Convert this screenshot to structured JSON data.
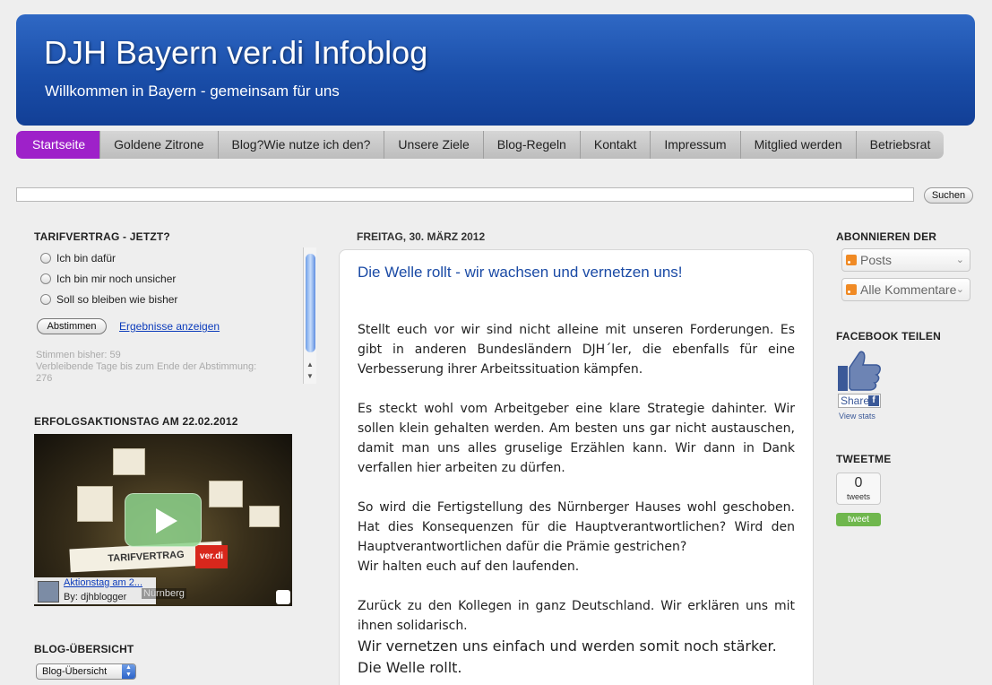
{
  "header": {
    "title": "DJH Bayern ver.di Infoblog",
    "subtitle": "Willkommen in Bayern - gemeinsam für uns",
    "accent_color": "#1a4ea9"
  },
  "nav": {
    "active_color": "#9e21c9",
    "tabs": [
      {
        "label": "Startseite"
      },
      {
        "label": "Goldene Zitrone"
      },
      {
        "label": "Blog?Wie nutze ich den?"
      },
      {
        "label": "Unsere Ziele"
      },
      {
        "label": "Blog-Regeln"
      },
      {
        "label": "Kontakt"
      },
      {
        "label": "Impressum"
      },
      {
        "label": "Mitglied werden"
      },
      {
        "label": "Betriebsrat"
      }
    ]
  },
  "search": {
    "button_label": "Suchen",
    "value": ""
  },
  "poll": {
    "title": "TARIFVERTRAG - JETZT?",
    "options": [
      "Ich bin dafür",
      "Ich bin mir noch unsicher",
      "Soll so bleiben wie bisher"
    ],
    "vote_label": "Abstimmen",
    "results_label": "Ergebnisse anzeigen",
    "votes_text": "Stimmen bisher: 59",
    "days_text": "Verbleibende Tage bis zum Ende der Abstimmung:",
    "days_value": "276"
  },
  "video": {
    "section_title": "ERFOLGSAKTIONSTAG AM 22.02.2012",
    "caption_title": "Aktionstag am 2...",
    "caption_by": "By: djhblogger",
    "location": "Nürnberg",
    "banner_text": "TARIFVERTRAG",
    "logo_text": "ver.di"
  },
  "archive": {
    "title": "BLOG-ÜBERSICHT",
    "select_value": "Blog-Übersicht"
  },
  "post": {
    "date": "FREITAG, 30. MÄRZ 2012",
    "title": "Die Welle rollt - wir wachsen und vernetzen uns!",
    "paragraphs": [
      "Stellt euch vor wir sind nicht alleine mit unseren Forderungen. Es gibt in anderen Bundesländern DJH´ler, die ebenfalls für eine Verbesserung ihrer Arbeitssituation kämpfen.",
      "Es steckt wohl vom Arbeitgeber eine klare Strategie dahinter. Wir sollen klein gehalten werden. Am besten uns gar nicht austauschen, damit man uns alles gruselige Erzählen kann. Wir dann in Dank verfallen hier arbeiten zu dürfen.",
      "So wird die Fertigstellung des Nürnberger Hauses wohl geschoben. Hat dies Konsequenzen für die Hauptverantwortlichen? Wird den Hauptverantwortlichen dafür die Prämie gestrichen?",
      "Wir halten euch auf den laufenden.",
      "Zurück zu den Kollegen in ganz Deutschland. Wir erklären uns mit ihnen solidarisch.",
      "Wir vernetzen uns einfach und werden somit noch stärker.",
      "Die Welle rollt."
    ]
  },
  "sidebar_right": {
    "subscribe_title": "ABONNIEREN DER",
    "feed_posts": "Posts",
    "feed_comments": "Alle Kommentare",
    "facebook_title": "FACEBOOK TEILEN",
    "share_label": "Share",
    "view_stats": "View stats",
    "tweetme_title": "TWEETME",
    "tweet_count": "0",
    "tweets_label": "tweets",
    "tweet_button": "tweet"
  }
}
